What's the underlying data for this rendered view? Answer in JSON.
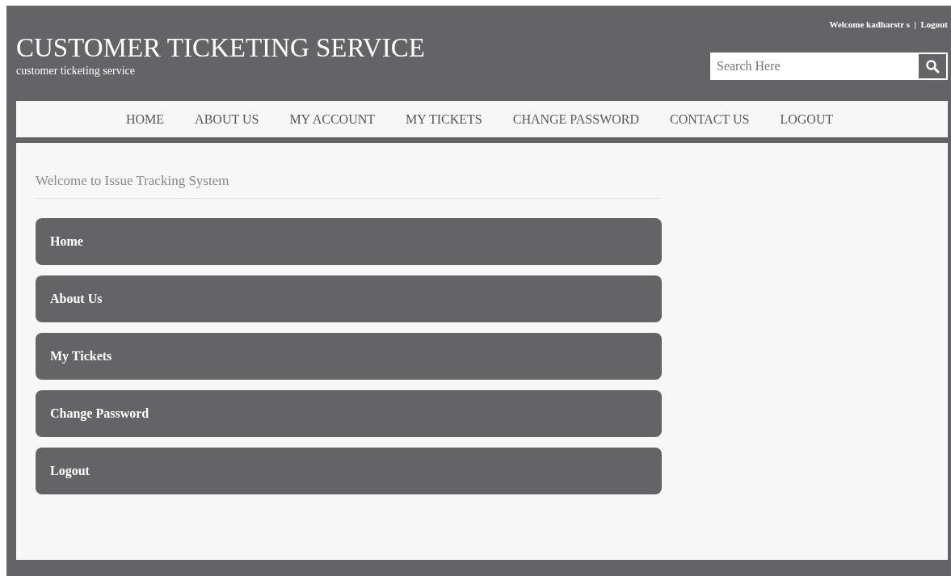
{
  "header": {
    "welcome": "Welcome kadharstr s",
    "separator": "|",
    "logout_link": "Logout",
    "title": "CUSTOMER TICKETING SERVICE",
    "subtitle": "customer ticketing service",
    "search": {
      "placeholder": "Search Here"
    }
  },
  "nav": [
    {
      "label": "HOME"
    },
    {
      "label": "ABOUT US"
    },
    {
      "label": "MY ACCOUNT"
    },
    {
      "label": "MY TICKETS"
    },
    {
      "label": "CHANGE PASSWORD"
    },
    {
      "label": "CONTACT US"
    },
    {
      "label": "LOGOUT"
    }
  ],
  "content": {
    "heading": "Welcome to Issue Tracking System",
    "menu": [
      {
        "label": "Home"
      },
      {
        "label": "About Us"
      },
      {
        "label": "My Tickets"
      },
      {
        "label": "Change Password"
      },
      {
        "label": "Logout"
      }
    ]
  }
}
